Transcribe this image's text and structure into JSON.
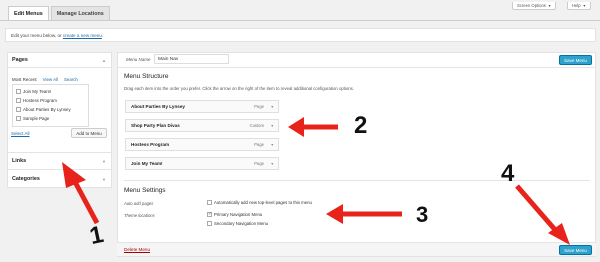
{
  "tabs": [
    {
      "label": "Edit Menus",
      "active": true
    },
    {
      "label": "Manage Locations",
      "active": false
    }
  ],
  "top_buttons": {
    "screen_options": "Screen Options",
    "help": "Help"
  },
  "notice": {
    "text": "Edit your menu below, or ",
    "link": "create a new menu",
    "suffix": "."
  },
  "sidebar": {
    "pages": {
      "title": "Pages",
      "tabs": [
        "Most Recent",
        "View All",
        "Search"
      ],
      "items": [
        "Join My Team!",
        "Hostess Program",
        "About Parties By Lynsey",
        "Sample Page"
      ],
      "select_all": "Select All",
      "add_button": "Add to Menu"
    },
    "links": {
      "title": "Links"
    },
    "categories": {
      "title": "Categories"
    }
  },
  "menu": {
    "name_label": "Menu Name",
    "name_value": "Main Nav",
    "save_label": "Save Menu",
    "structure_title": "Menu Structure",
    "structure_desc": "Drag each item into the order you prefer. Click the arrow on the right of the item to reveal additional configuration options.",
    "items": [
      {
        "title": "About Parties By Lynsey",
        "type": "Page"
      },
      {
        "title": "Shop Party Plan Divas",
        "type": "Custom"
      },
      {
        "title": "Hostess Program",
        "type": "Page"
      },
      {
        "title": "Join My Team!",
        "type": "Page"
      }
    ],
    "settings_title": "Menu Settings",
    "auto_add_label": "Auto add pages",
    "auto_add_option": "Automatically add new top-level pages to this menu",
    "auto_add_checked": false,
    "locations_label": "Theme locations",
    "locations": [
      {
        "label": "Primary Navigation Menu",
        "checked": true
      },
      {
        "label": "Secondary Navigation Menu",
        "checked": false
      }
    ],
    "delete_label": "Delete Menu"
  },
  "annotations": [
    "1",
    "2",
    "3",
    "4"
  ],
  "colors": {
    "accent": "#2ea2cc",
    "arrow": "#e8231b",
    "link": "#1e6aa8"
  }
}
